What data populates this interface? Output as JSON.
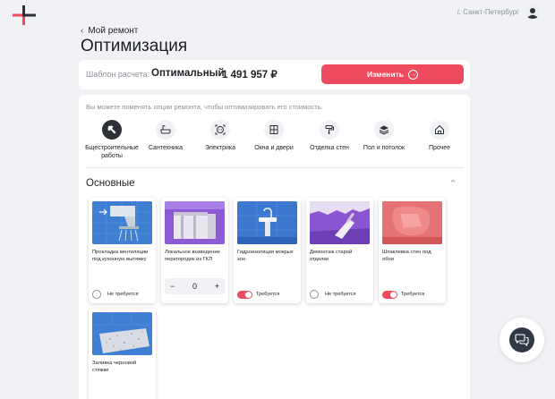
{
  "header": {
    "city": "г. Санкт-Петербург"
  },
  "nav": {
    "back_label": "Мой ремонт"
  },
  "page": {
    "title": "Оптимизация"
  },
  "template": {
    "label": "Шаблон расчета:",
    "name": "Оптимальный",
    "price": "1 491 957 ₽",
    "change_label": "Изменить"
  },
  "hint": "Вы можете поменять опции ремонта, чтобы оптимизировать его стоимость.",
  "categories": [
    {
      "label1": "Бщестроительные",
      "label2": "работы",
      "icon": "hammer-icon",
      "active": true
    },
    {
      "label1": "Сантехника",
      "label2": "",
      "icon": "bathtub-icon",
      "active": false
    },
    {
      "label1": "Электрика",
      "label2": "",
      "icon": "socket-icon",
      "active": false
    },
    {
      "label1": "Окна и двери",
      "label2": "",
      "icon": "window-icon",
      "active": false
    },
    {
      "label1": "Отделка стен",
      "label2": "",
      "icon": "paint-roller-icon",
      "active": false
    },
    {
      "label1": "Пол и потолок",
      "label2": "",
      "icon": "layers-icon",
      "active": false
    },
    {
      "label1": "Прочее",
      "label2": "",
      "icon": "house-icon",
      "active": false
    }
  ],
  "section": {
    "title": "Основные"
  },
  "cards": [
    {
      "name": "Прокладка вентиляции под кухонную вытяжку",
      "control": "radio",
      "status": "Не требуется"
    },
    {
      "name": "Локальное возведение перегородок из ГКЛ",
      "control": "stepper",
      "value": "0",
      "minus": "−",
      "plus": "+"
    },
    {
      "name": "Гидроизоляция мокрых зон",
      "control": "toggle",
      "status": "Требуется"
    },
    {
      "name": "Демонтаж старой отделки",
      "control": "radio",
      "status": "Не требуется"
    },
    {
      "name": "Шпаклевка стен под обои",
      "control": "toggle",
      "status": "Требуется"
    },
    {
      "name": "Заливка черновой стяжки",
      "control": "none",
      "status": ""
    }
  ],
  "colors": {
    "accent": "#f04a5e",
    "dark": "#2d3037",
    "background": "#f1f2f5"
  }
}
